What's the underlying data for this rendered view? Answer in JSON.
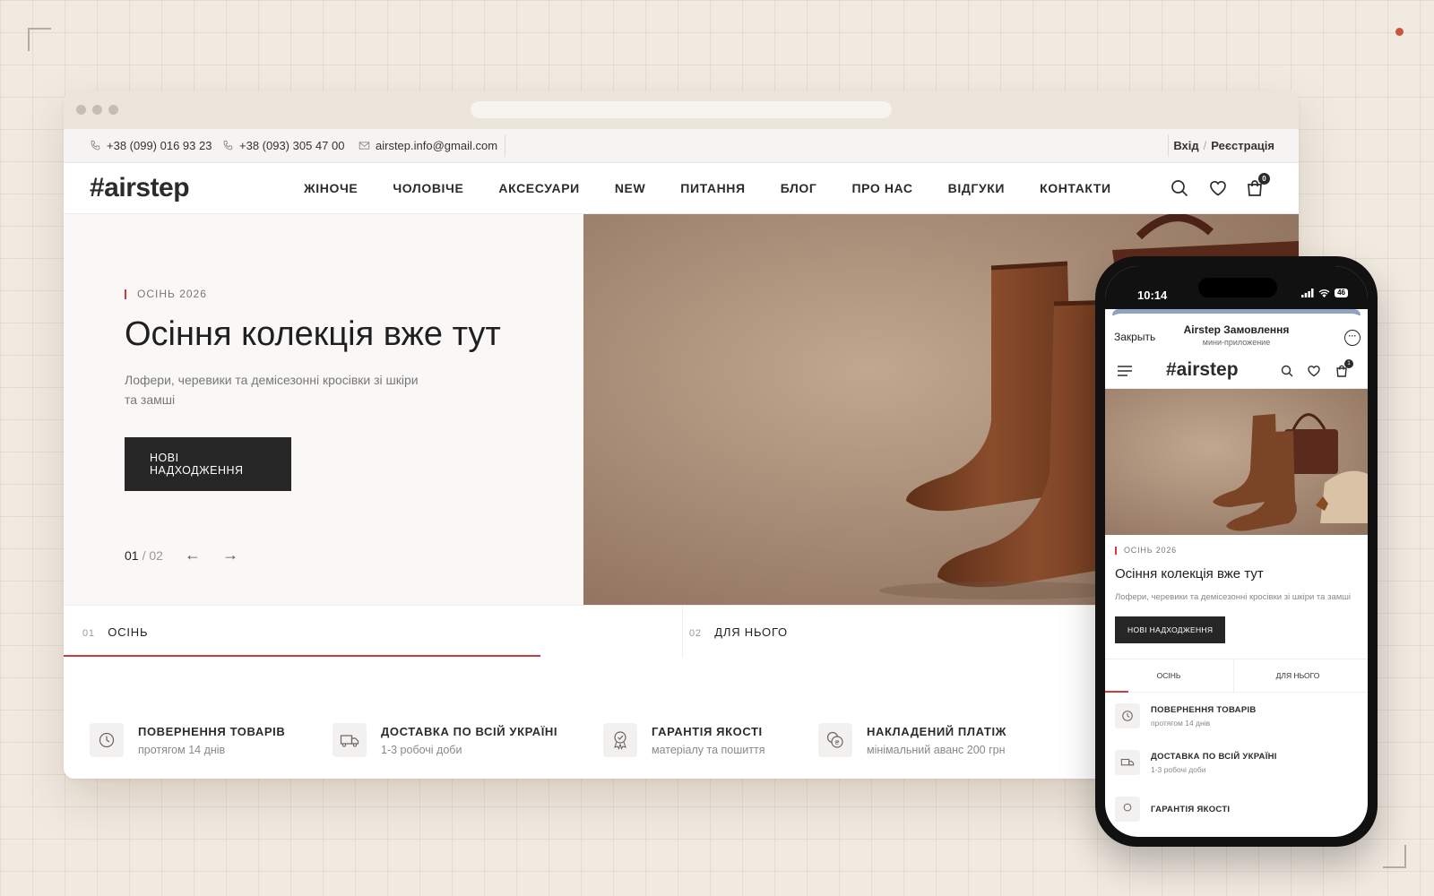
{
  "topbar": {
    "phone1": "+38 (099) 016 93 23",
    "phone2": "+38 (093) 305 47 00",
    "email": "airstep.info@gmail.com",
    "login": "Вхід",
    "register": "Реєстрація"
  },
  "nav": {
    "logo": "#airstep",
    "items": [
      "ЖІНОЧЕ",
      "ЧОЛОВІЧЕ",
      "АКСЕСУАРИ",
      "NEW",
      "ПИТАННЯ",
      "БЛОГ",
      "ПРО НАС",
      "ВІДГУКИ",
      "КОНТАКТИ"
    ],
    "cart_count": "0"
  },
  "hero": {
    "eyebrow": "ОСІНЬ 2026",
    "title": "Осіння колекція вже тут",
    "subtitle": "Лофери, черевики та демісезонні кросівки зі шкіри та замші",
    "button": "НОВІ НАДХОДЖЕННЯ",
    "page_current": "01",
    "page_total": "/ 02",
    "prev_arrow": "←",
    "next_arrow": "→"
  },
  "tabs": [
    {
      "num": "01",
      "label": "ОСІНЬ"
    },
    {
      "num": "02",
      "label": "ДЛЯ НЬОГО"
    }
  ],
  "features": [
    {
      "icon": "history-icon",
      "title": "ПОВЕРНЕННЯ ТОВАРІВ",
      "sub": "протягом 14 днів"
    },
    {
      "icon": "truck-icon",
      "title": "ДОСТАВКА ПО ВСІЙ УКРАЇНІ",
      "sub": "1-3 робочі доби"
    },
    {
      "icon": "badge-icon",
      "title": "ГАРАНТІЯ ЯКОСТІ",
      "sub": "матеріалу та пошиття"
    },
    {
      "icon": "coins-icon",
      "title": "НАКЛАДЕНИЙ ПЛАТІЖ",
      "sub": "мінімальний аванс 200 грн"
    }
  ],
  "phone": {
    "time": "10:14",
    "battery": "46",
    "close": "Закрыть",
    "miniapp_title": "Airstep Замовлення",
    "miniapp_sub": "мини-приложение",
    "more": "···",
    "logo": "#airstep",
    "cart_count": "1",
    "eyebrow": "ОСІНЬ 2026",
    "title": "Осіння колекція вже тут",
    "subtitle": "Лофери, черевики та демісезонні кросівки зі шкіри та замші",
    "button": "НОВІ НАДХОДЖЕННЯ",
    "tabs": [
      "ОСІНЬ",
      "ДЛЯ НЬОГО"
    ],
    "features": [
      {
        "title": "ПОВЕРНЕННЯ ТОВАРІВ",
        "sub": "протягом 14 днів"
      },
      {
        "title": "ДОСТАВКА ПО ВСІЙ УКРАЇНІ",
        "sub": "1-3 робочі доби"
      },
      {
        "title": "ГАРАНТІЯ ЯКОСТІ",
        "sub": ""
      }
    ]
  },
  "colors": {
    "accent": "#d23a3a",
    "button": "#262626",
    "background": "#f1eae1",
    "boot": "#7a4427"
  }
}
